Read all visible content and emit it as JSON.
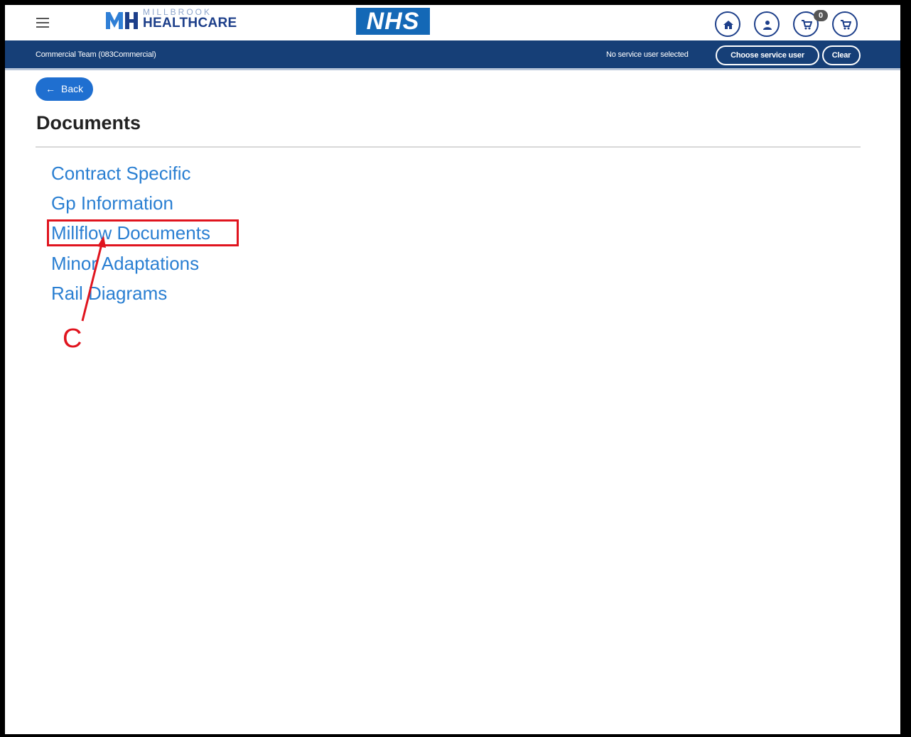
{
  "header": {
    "logo_line1": "MILLBROOK",
    "logo_line2": "HEALTHCARE",
    "nhs_logo": "NHS",
    "cart_count": "0",
    "icons": [
      "home-icon",
      "user-icon",
      "cart-icon",
      "cart-icon"
    ]
  },
  "service_bar": {
    "team": "Commercial Team (083Commercial)",
    "status": "No service user selected",
    "choose_button": "Choose service user",
    "clear_button": "Clear"
  },
  "back_button": {
    "label": "Back",
    "arrow": "←"
  },
  "page": {
    "title": "Documents",
    "items": [
      "Contract Specific",
      "Gp Information",
      "Millflow Documents",
      "Minor Adaptations",
      "Rail Diagrams"
    ]
  },
  "annotation": {
    "label": "C"
  },
  "colors": {
    "navy": "#163f77",
    "link": "#2a7fd2",
    "back_button": "#1f6fd0",
    "annotation": "#e0141e",
    "nhs_blue": "#1468b6"
  }
}
